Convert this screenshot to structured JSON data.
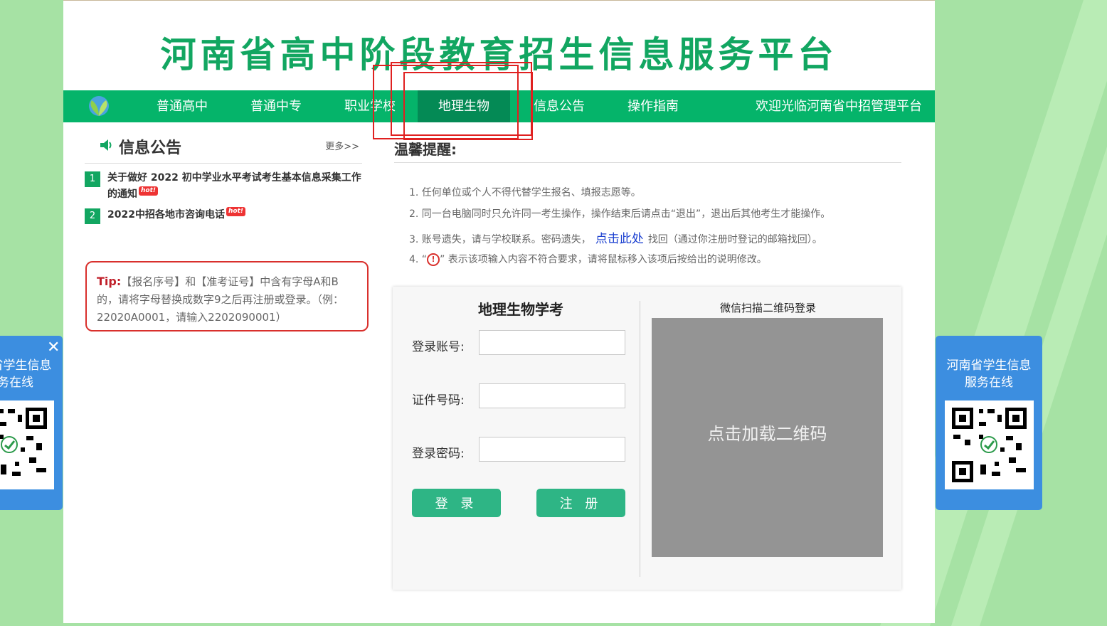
{
  "site": {
    "title": "河南省高中阶段教育招生信息服务平台"
  },
  "nav": {
    "items": [
      {
        "label": "普通高中"
      },
      {
        "label": "普通中专"
      },
      {
        "label": "职业学校"
      },
      {
        "label": "地理生物",
        "active": true
      },
      {
        "label": "信息公告"
      },
      {
        "label": "操作指南"
      }
    ],
    "welcome": "欢迎光临河南省中招管理平台"
  },
  "notices": {
    "title": "信息公告",
    "more": "更多>>",
    "items": [
      {
        "num": "1",
        "text": "关于做好 2022 初中学业水平考试考生基本信息采集工作的通知",
        "badge": "hot!"
      },
      {
        "num": "2",
        "text": "2022中招各地市咨询电话",
        "badge": "hot!"
      }
    ]
  },
  "tip": {
    "label": "Tip:",
    "text": "【报名序号】和【准考证号】中含有字母A和B的，请将字母替换成数字9之后再注册或登录。（例：22020A0001，请输入2202090001）"
  },
  "reminder": {
    "title": "温馨提醒:",
    "items": {
      "one": "1. 任何单位或个人不得代替学生报名、填报志愿等。",
      "two": "2. 同一台电脑同时只允许同一考生操作，操作结束后请点击“退出”，退出后其他考生才能操作。",
      "three_prefix": "3. 账号遗失，请与学校联系。密码遗失，",
      "three_link": "点击此处",
      "three_suffix": "找回（通过你注册时登记的邮箱找回）。",
      "four_prefix": "4. “",
      "four_icon": "!",
      "four_suffix": "” 表示该项输入内容不符合要求，请将鼠标移入该项后按给出的说明修改。"
    }
  },
  "login": {
    "title": "地理生物学考",
    "account_label": "登录账号:",
    "account_value": "",
    "id_label": "证件号码:",
    "id_value": "",
    "password_label": "登录密码:",
    "password_value": "",
    "login_button": "登 录",
    "register_button": "注 册",
    "qr_title": "微信扫描二维码登录",
    "qr_load": "点击加载二维码"
  },
  "side": {
    "left_text": "河南省学生信息服务在线",
    "right_text": "河南省学生信息服务在线",
    "close": "✕"
  },
  "colors": {
    "brand_green": "#05b46a",
    "active_green": "#048a55",
    "title_green": "#12a661",
    "button_green": "#2eb585",
    "side_blue": "#3c8ee0",
    "tip_red": "#d9302c"
  }
}
